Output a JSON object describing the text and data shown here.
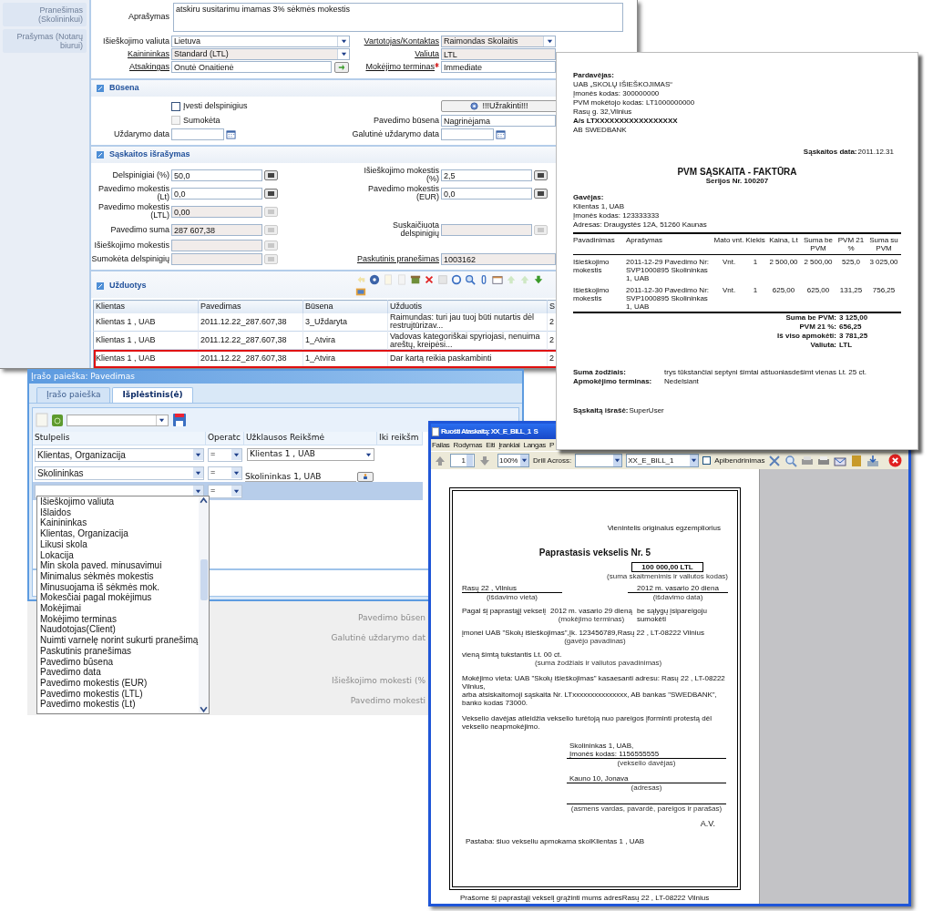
{
  "main_window": {
    "sidebar_items": [
      {
        "label": "Pranešimas (Skolininkui)",
        "disabled": true
      },
      {
        "label": "Prašymas (Notarų biurui)",
        "disabled": true
      }
    ],
    "description": {
      "label": "Aprašymas",
      "value": "atskiru susitarimu imamas 3% sėkmės mokestis"
    },
    "header_rows": [
      {
        "left": {
          "label": "Išieškojimo valiuta",
          "value": "Lietuva",
          "kind": "select"
        },
        "right": {
          "label": "Vartotojas/Kontaktas",
          "value": "Raimondas Skolaitis",
          "kind": "select",
          "link": true,
          "readonly": true
        }
      },
      {
        "left": {
          "label": "Kainininkas",
          "value": "Standard (LTL)",
          "kind": "select",
          "link": true,
          "readonly": true
        },
        "right": {
          "label": "Valiuta",
          "value": "LTL",
          "kind": "text",
          "link": true,
          "readonly": true
        }
      },
      {
        "left": {
          "label": "Atsakingas",
          "value": "Onutė Onaitienė",
          "kind": "lookup",
          "link": true
        },
        "right": {
          "label": "Mokėjimo terminas",
          "value": "Immediate",
          "kind": "text",
          "link": true,
          "required": true
        }
      }
    ],
    "sections": [
      {
        "title": "Būsena",
        "rows": [
          {
            "left": {
              "kind": "checkbox",
              "label": "Įvesti delspinigius",
              "checked": false,
              "disabled": false
            },
            "right": {
              "kind": "button",
              "label": "!!!Užrakinti!!!"
            }
          },
          {
            "left": {
              "kind": "checkbox",
              "label": "Sumokėta",
              "checked": false,
              "disabled": true
            },
            "right": {
              "label": "Pavedimo būsena",
              "value": "Nagrinėjama",
              "kind": "text"
            }
          },
          {
            "left": {
              "label": "Uždarymo data",
              "kind": "date"
            },
            "right": {
              "label": "Galutinė uždarymo data",
              "kind": "date"
            }
          }
        ]
      },
      {
        "title": "Sąskaitos išrašymas",
        "rows": [
          {
            "left": {
              "label": "Delspinigiai (%)",
              "value": "50,0",
              "kind": "number"
            },
            "right": {
              "label": "Išieškojimo mokestis (%)",
              "value": "2,5",
              "kind": "number"
            }
          },
          {
            "left": {
              "label": "Pavedimo mokestis (Lt)",
              "value": "0,0",
              "kind": "number"
            },
            "right": {
              "label": "Pavedimo mokestis (EUR)",
              "value": "0,0",
              "kind": "number"
            }
          },
          {
            "left": {
              "label": "Pavedimo mokestis (LTL)",
              "value": "0,00",
              "kind": "number",
              "readonly": true
            }
          },
          {
            "left": {
              "label": "Pavedimo suma",
              "value": "287 607,38",
              "kind": "number",
              "readonly": true
            },
            "right": {
              "label": "Suskaičiuota delspinigių",
              "kind": "number",
              "readonly": true
            }
          },
          {
            "left": {
              "label": "Išieškojimo mokestis",
              "kind": "number",
              "readonly": true
            }
          },
          {
            "left": {
              "label": "Sumokėta delspinigių",
              "kind": "number",
              "readonly": true
            },
            "right": {
              "label": "Paskutinis pranešimas",
              "value": "1003162",
              "kind": "text",
              "link": true,
              "readonly": true
            }
          }
        ]
      }
    ],
    "tasks": {
      "title": "Užduotys",
      "columns": [
        "Klientas",
        "Pavedimas",
        "Būsena",
        "Užduotis",
        "S"
      ],
      "rows": [
        {
          "cells": [
            "Klientas 1 , UAB",
            "2011.12.22_287.607,38",
            "3_Uždaryta",
            "Raimundas: turi jau tuoj būti nutartis dėl restrujtūrizav...",
            "2"
          ],
          "selected": false
        },
        {
          "cells": [
            "Klientas 1 , UAB",
            "2011.12.22_287.607,38",
            "1_Atvira",
            "Vadovas kategoriškai spyriojasi, nenuima areštų, kreipėsi...",
            "2"
          ],
          "selected": false
        },
        {
          "cells": [
            "Klientas 1 , UAB",
            "2011.12.22_287.607,38",
            "1_Atvira",
            "Dar kartą reikia paskambinti",
            "2"
          ],
          "selected": true
        }
      ]
    }
  },
  "background_form_labels": [
    "Pavedimo būsen",
    "Galutinė uždarymo dat",
    "Išieškojimo mokesti (%",
    "Pavedimo mokesti"
  ],
  "search_window": {
    "title": "Įrašo paieška: Pavedimas",
    "tabs": [
      {
        "label": "Įrašo paieška",
        "selected": false
      },
      {
        "label": "Išplėstinis(ė)",
        "selected": true
      }
    ],
    "columns": [
      "Stulpelis",
      "Operatc",
      "Užklausos Reikšmė",
      "Iki reikšm"
    ],
    "rows": [
      {
        "column": "Klientas, Organizacija",
        "operator": "=",
        "value": "Klientas 1 , UAB",
        "kind": "select",
        "selected": false
      },
      {
        "column": "Skolininkas",
        "operator": "=",
        "value": "Skolininkas 1, UAB",
        "kind": "lookup",
        "selected": false
      },
      {
        "operator": "=",
        "kind": "empty",
        "selected": true
      }
    ],
    "dropdown_items": [
      "Išieškojimo valiuta",
      "Išlaidos",
      "Kainininkas",
      "Klientas, Organizacija",
      "Likusi skola",
      "Lokacija",
      "Min skola paved. minusavimui",
      "Minimalus sėkmės mokestis",
      "Minusuojama iš sėkmės mok.",
      "Mokesčiai pagal mokėjimus",
      "Mokėjimai",
      "Mokėjimo terminas",
      "Naudotojas(Client)",
      "Nuimti varnelę norint sukurti pranešimą",
      "Paskutinis pranešimas",
      "Pavedimo būsena",
      "Pavedimo data",
      "Pavedimo mokestis (EUR)",
      "Pavedimo mokestis (LTL)",
      "Pavedimo mokestis (Lt)"
    ]
  },
  "report_window": {
    "title": "Ruošti Ataskaitą: XX_E_BILL_1  S",
    "menu": [
      "Failas",
      "Rodymas",
      "Eiti",
      "Įrankiai",
      "Langas",
      "P"
    ],
    "page": "1",
    "zoom": "100%",
    "drill_label": "Drill Across:",
    "report": "XX_E_BILL_1",
    "summary_checkbox": {
      "label": "Apibendrinimas",
      "checked": false
    },
    "document": {
      "original_note": "Vienintelis originalus egzempliorius",
      "title": "Paprastasis vekselis Nr. 5",
      "amount": "100 000,00 LTL",
      "amount_caption": "(suma skaitmenimis ir valiutos kodas)",
      "place": "Rasų 22 , Vilnius",
      "place_caption": "(išdavimo vieta)",
      "date": "2012 m. vasario  20 diena",
      "date_caption": "(išdavimo data)",
      "promise_start": "Pagal šį paprastąjį vekselį",
      "due": "2012 m. vasario  29 dieną",
      "due_caption": "(mokėjimo terminas)",
      "promise_end": "be sąlygų įsipareigoju sumokėti",
      "payee": "įmonei  UAB \"Skolų išieškojimas\",Įk. 123456789,Rasų 22 , LT-08222 Vilnius",
      "payee_caption": "(gavėjo pavadinas)",
      "words": "vieną šimtą tukstantis  Lt. 00 ct.",
      "words_caption": "(suma žodžiais ir valiutos pavadinimas)",
      "payment_place": [
        "Mokėjimo vieta:  UAB \"Skolų išieškojimas\" kasaesanti adresu: Rasų 22 , LT-08222 Vilnius,",
        "arba atsiskaitomoji sąskaita Nr. LTxxxxxxxxxxxxxxx, AB bankas \"SWEDBANK\", banko kodas 73000."
      ],
      "waiver": "Vekselio davėjas atleidžia vekselio turėtoją nuo pareigos įforminti protestą dėl vekselio neapmokėjimo.",
      "drawer": [
        "Skolininkas 1, UAB,",
        "Įmonės kodas: 1156555555"
      ],
      "drawer_caption": "(vekselio davėjas)",
      "address": "Kauno 10,  Jonava",
      "address_caption": "(adresas)",
      "sign_caption": "(asmens vardas, pavardė, pareigos ir parašas)",
      "stamp": "A.V.",
      "note": "Pastaba: šiuo vekseliu apmokama skolKlientas 1 , UAB",
      "footer": "Prašome šį paprastąjį vekselį grąžinti mums adresRasų 22 , LT-08222 Vilnius"
    }
  },
  "invoice": {
    "seller_title": "Pardavėjas:",
    "seller_lines": [
      "UAB „SKOLŲ IŠIEŠKOJIMAS“",
      "Įmonės kodas: 300000000",
      "PVM mokėtojo kodas: LT1000000000",
      "Rasų g. 32,Vilnius"
    ],
    "seller_account": "A/s LTXXXXXXXXXXXXXXXXX",
    "seller_bank": "AB SWEDBANK",
    "date_label": "Sąskaitos data:",
    "date": "2011.12.31",
    "title": "PVM SĄSKAITA - FAKTŪRA",
    "series": "Serijos Nr.  100207",
    "buyer_title": "Gavėjas:",
    "buyer_lines": [
      "Klientas 1, UAB",
      "Įmonės kodas:  123333333",
      "Adresas:  Draugystės 12A, 51260 Kaunas"
    ],
    "columns": [
      "Pavadinimas",
      "Aprašymas",
      "Mato vnt.",
      "Kiekis",
      "Kaina, Lt",
      "Suma be PVM",
      "PVM 21 %",
      "Suma su PVM"
    ],
    "rows": [
      [
        "Išieškojimo mokestis",
        "2011-12-29 Pavedimo Nr: SVP1000895 Skolininkas 1, UAB",
        "Vnt.",
        "1",
        "2 500,00",
        "2 500,00",
        "525,0",
        "3 025,00"
      ],
      [
        "Išieškojimo mokestis",
        "2011-12-30 Pavedimo Nr: SVP1000895 Skolininkas 1, UAB",
        "Vnt.",
        "1",
        "625,00",
        "625,00",
        "131,25",
        "756,25"
      ]
    ],
    "totals": [
      {
        "label": "Suma be PVM:",
        "value": "3 125,00"
      },
      {
        "label": "PVM 21 %:",
        "value": "656,25"
      },
      {
        "label": "Iš viso apmokėti:",
        "value": "3 781,25"
      },
      {
        "label": "Valiuta:",
        "value": "LTL"
      }
    ],
    "notes": [
      {
        "label": "Suma žodžiais:",
        "value": "trys tūkstančiai septyni šimtai aštuoniasdešimt vienas Lt. 25 ct."
      },
      {
        "label": "Apmokėjimo terminas:",
        "value": "Nedelsiant"
      }
    ],
    "issuer_label": "Sąskaitą išrašė:",
    "issuer": "SuperUser"
  }
}
